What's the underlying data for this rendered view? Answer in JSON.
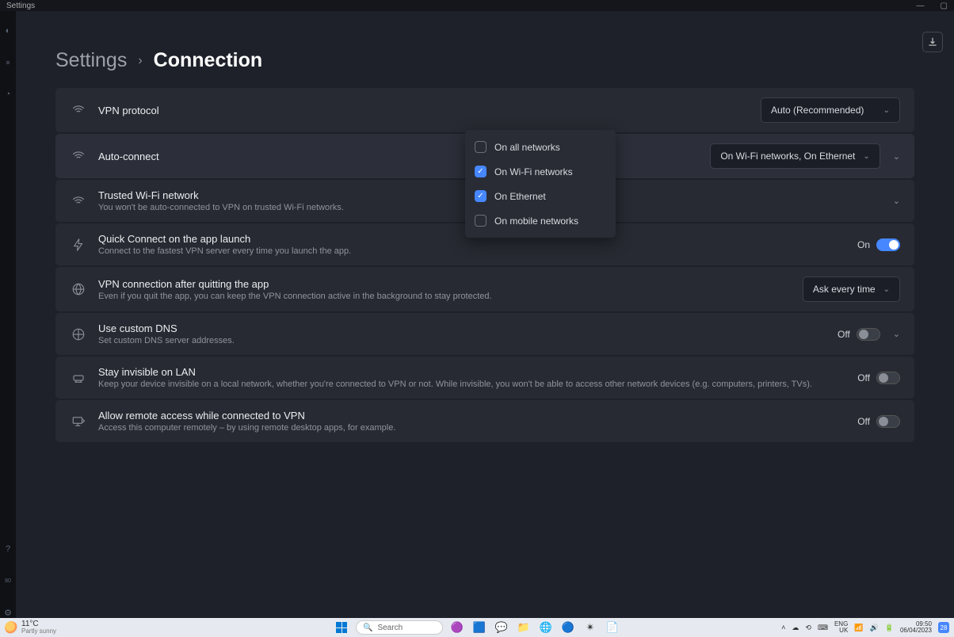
{
  "titlebar": {
    "title": "Settings"
  },
  "breadcrumb": {
    "parent": "Settings",
    "current": "Connection"
  },
  "vpn_protocol": {
    "title": "VPN protocol",
    "selected": "Auto (Recommended)"
  },
  "auto_connect": {
    "title": "Auto-connect",
    "selected": "On Wi-Fi networks, On Ethernet",
    "options": [
      {
        "label": "On all networks",
        "checked": false
      },
      {
        "label": "On Wi-Fi networks",
        "checked": true
      },
      {
        "label": "On Ethernet",
        "checked": true
      },
      {
        "label": "On mobile networks",
        "checked": false
      }
    ]
  },
  "trusted_wifi": {
    "title": "Trusted Wi-Fi network",
    "sub": "You won't be auto-connected to VPN on trusted Wi-Fi networks."
  },
  "quick_connect": {
    "title": "Quick Connect on the app launch",
    "sub": "Connect to the fastest VPN server every time you launch the app.",
    "state_label": "On",
    "on": true
  },
  "after_quit": {
    "title": "VPN connection after quitting the app",
    "sub": "Even if you quit the app, you can keep the VPN connection active in the background to stay protected.",
    "selected": "Ask every time"
  },
  "custom_dns": {
    "title": "Use custom DNS",
    "sub": "Set custom DNS server addresses.",
    "state_label": "Off",
    "on": false
  },
  "invisible_lan": {
    "title": "Stay invisible on LAN",
    "sub": "Keep your device invisible on a local network, whether you're connected to VPN or not. While invisible, you won't be able to access other network devices (e.g. computers, printers, TVs).",
    "state_label": "Off",
    "on": false
  },
  "remote_access": {
    "title": "Allow remote access while connected to VPN",
    "sub": "Access this computer remotely – by using remote desktop apps, for example.",
    "state_label": "Off",
    "on": false
  },
  "taskbar": {
    "temp": "11°C",
    "weather": "Partly sunny",
    "search_placeholder": "Search",
    "lang1": "ENG",
    "lang2": "UK",
    "time": "09:50",
    "date": "06/04/2023",
    "notif": "28"
  }
}
